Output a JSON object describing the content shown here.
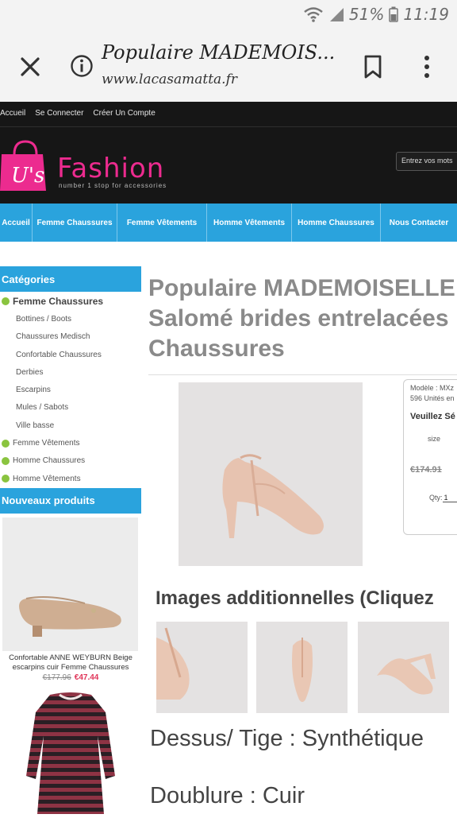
{
  "status_bar": {
    "battery": "51%",
    "time": "11:19"
  },
  "browser": {
    "page_title": "Populaire MADEMOIS...",
    "domain": "www.lacasamatta.fr"
  },
  "top_links": [
    "Accueil",
    "Se Connecter",
    "Créer Un Compte"
  ],
  "logo": {
    "badge": "U's",
    "brand": "Fashion",
    "tagline": "number 1 stop for accessories"
  },
  "search": {
    "placeholder": "Entrez vos mots"
  },
  "nav": [
    "Accueil",
    "Femme Chaussures",
    "Femme Vêtements",
    "Homme Vêtements",
    "Homme Chaussures",
    "Nous Contacter"
  ],
  "sidebar": {
    "categories_title": "Catégories",
    "categories": [
      {
        "label": "Femme Chaussures",
        "level": "main"
      },
      {
        "label": "Bottines / Boots",
        "level": "sub"
      },
      {
        "label": "Chaussures Medisch",
        "level": "sub"
      },
      {
        "label": "Confortable Chaussures",
        "level": "sub"
      },
      {
        "label": "Derbies",
        "level": "sub"
      },
      {
        "label": "Escarpins",
        "level": "sub"
      },
      {
        "label": "Mules / Sabots",
        "level": "sub"
      },
      {
        "label": "Ville basse",
        "level": "sub"
      },
      {
        "label": "Femme Vêtements",
        "level": "top"
      },
      {
        "label": "Homme Chaussures",
        "level": "top"
      },
      {
        "label": "Homme Vêtements",
        "level": "top"
      }
    ],
    "new_products_title": "Nouveaux produits",
    "new_product": {
      "name": "Confortable ANNE WEYBURN Beige escarpins cuir Femme Chaussures",
      "old_price": "€177.96",
      "price": "€47.44"
    }
  },
  "product": {
    "title_lines": [
      "Populaire MADEMOISELLE",
      "Salomé brides entrelacées",
      "Chaussures"
    ],
    "model": "Modèle : MXz",
    "stock": "596 Unités en",
    "select_prompt": "Veuillez Sé",
    "size_label": "size",
    "old_price": "€174.91",
    "qty_label": "Qty:",
    "qty_value": "1",
    "additional_images_title": "Images additionnelles (Cliquez",
    "material_upper": "Dessus/ Tige : Synthétique",
    "material_lining": "Doublure : Cuir"
  },
  "colors": {
    "nav_blue": "#2aa3dd",
    "brand_pink": "#ec2b8f",
    "header_dark": "#161616",
    "bullet_green": "#8ac43f",
    "price_red": "#e0365a"
  }
}
